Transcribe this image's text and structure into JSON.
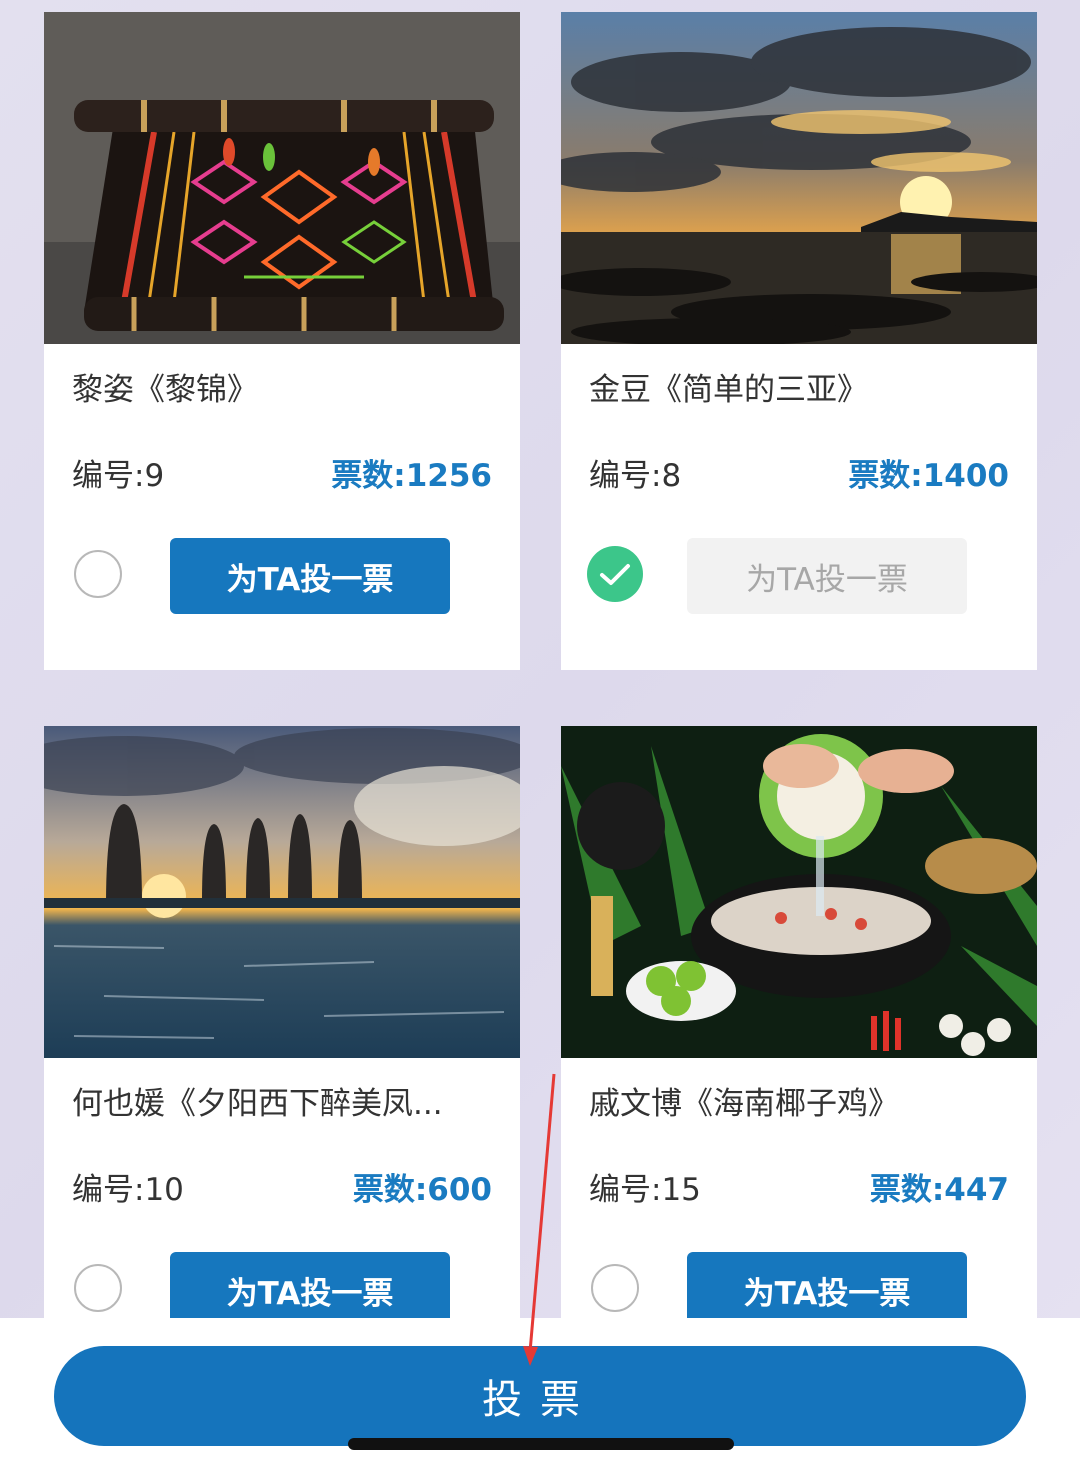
{
  "cards": [
    {
      "title": "黎姿《黎锦》",
      "num": "编号:9",
      "votes": "票数:1256",
      "button": "为TA投一票",
      "selected": false
    },
    {
      "title": "金豆《简单的三亚》",
      "num": "编号:8",
      "votes": "票数:1400",
      "button": "为TA投一票",
      "selected": true
    },
    {
      "title": "何也媛《夕阳西下醉美凤...",
      "num": "编号:10",
      "votes": "票数:600",
      "button": "为TA投一票",
      "selected": false
    },
    {
      "title": "戚文博《海南椰子鸡》",
      "num": "编号:15",
      "votes": "票数:447",
      "button": "为TA投一票",
      "selected": false
    }
  ],
  "submit_label": "投票",
  "colors": {
    "accent": "#1677be",
    "votes": "#1a7bc1",
    "check": "#3cc68a",
    "annotation": "#e53935"
  }
}
